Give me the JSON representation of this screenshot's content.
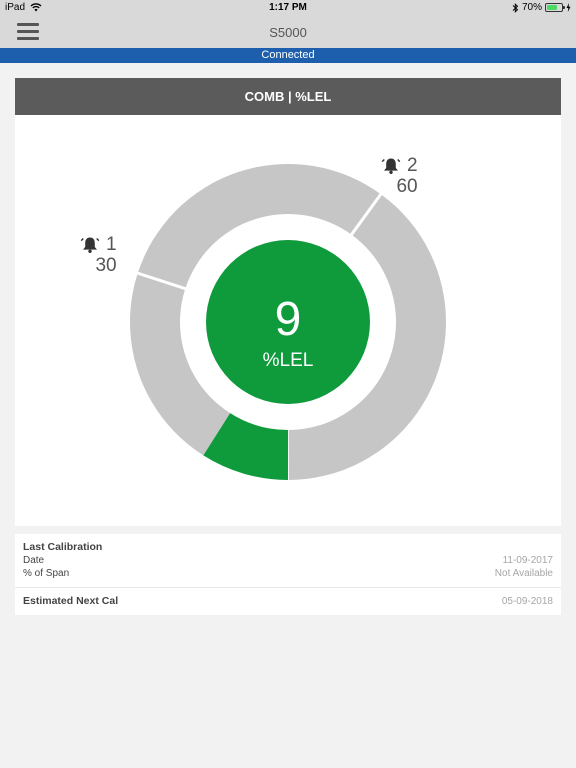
{
  "status_bar": {
    "device": "iPad",
    "time": "1:17 PM",
    "battery_percent": "70%",
    "battery_level": 0.7
  },
  "nav": {
    "title": "S5000"
  },
  "connection": {
    "status": "Connected"
  },
  "gauge": {
    "header": "COMB | %LEL",
    "value": "9",
    "unit": "%LEL",
    "max": 100,
    "value_color": "#0f9a3c",
    "track_color": "#c6c6c6",
    "alarms": [
      {
        "level": "1",
        "threshold": "30"
      },
      {
        "level": "2",
        "threshold": "60"
      }
    ]
  },
  "calibration": {
    "title": "Last Calibration",
    "rows": [
      {
        "label": "Date",
        "value": "11-09-2017"
      },
      {
        "label": "% of Span",
        "value": "Not Available"
      }
    ],
    "next_label": "Estimated Next Cal",
    "next_value": "05-09-2018"
  }
}
